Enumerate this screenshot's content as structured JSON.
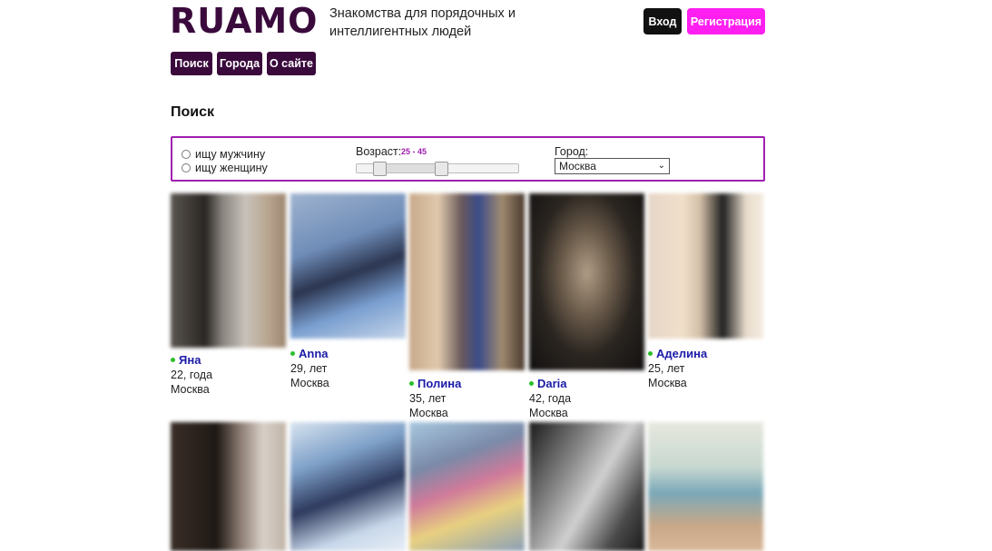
{
  "header": {
    "logo": "RUAMO",
    "tagline": "Знакомства для порядочных и интеллигентных людей",
    "login_label": "Вход",
    "register_label": "Регистрация"
  },
  "nav": {
    "items": [
      {
        "label": "Поиск"
      },
      {
        "label": "Города"
      },
      {
        "label": "О сайте"
      }
    ]
  },
  "search": {
    "title": "Поиск",
    "gender_options": [
      "ищу мужчину",
      "ищу женщину"
    ],
    "age_label": "Возраст:",
    "age_range": "25 - 45",
    "age_min": 25,
    "age_max": 45,
    "city_label": "Город:",
    "city_value": "Москва"
  },
  "profiles": [
    {
      "name": "Яна",
      "age": "22, года",
      "city": "Москва",
      "online": true
    },
    {
      "name": "Anna",
      "age": "29, лет",
      "city": "Москва",
      "online": true
    },
    {
      "name": "Полина",
      "age": "35, лет",
      "city": "Москва",
      "online": true
    },
    {
      "name": "Daria",
      "age": "42, года",
      "city": "Москва",
      "online": true
    },
    {
      "name": "Аделина",
      "age": "25, лет",
      "city": "Москва",
      "online": true
    }
  ],
  "colors": {
    "brand": "#3a0a3c",
    "accent": "#ff1ff0",
    "online": "#2bbf2b",
    "name_link": "#1a1aa8"
  }
}
